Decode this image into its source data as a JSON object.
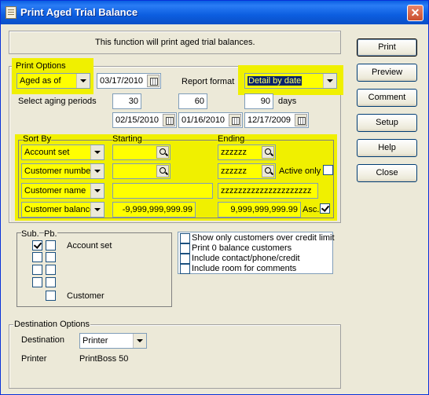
{
  "window": {
    "title": "Print Aged Trial Balance"
  },
  "info": {
    "text": "This function will print aged trial balances."
  },
  "buttons": {
    "print": "Print",
    "preview": "Preview",
    "comment": "Comment",
    "setup": "Setup",
    "help": "Help",
    "close": "Close"
  },
  "print_options": {
    "label": "Print Options",
    "aged_as_of": "Aged as of",
    "as_of_date": "03/17/2010",
    "report_format_label": "Report format",
    "report_format": "Detail by date",
    "aging_label": "Select aging periods",
    "periods": [
      "30",
      "60",
      "90"
    ],
    "days_label": "days",
    "period_dates": [
      "02/15/2010",
      "01/16/2010",
      "12/17/2009"
    ]
  },
  "sort": {
    "sort_by_label": "Sort By",
    "starting_label": "Starting",
    "ending_label": "Ending",
    "rows": [
      {
        "field": "Account set",
        "start": "",
        "end": "zzzzzz"
      },
      {
        "field": "Customer number",
        "start": "",
        "end": "zzzzzz"
      },
      {
        "field": "Customer name",
        "start": "",
        "end": "zzzzzzzzzzzzzzzzzzzzz"
      },
      {
        "field": "Customer balance",
        "start": "-9,999,999,999.99",
        "end": "9,999,999,999.99"
      }
    ],
    "active_only": "Active only",
    "asc": "Asc."
  },
  "sub_pb": {
    "sub_label": "Sub.",
    "pb_label": "Pb.",
    "account_set": "Account set",
    "customer": "Customer"
  },
  "options": [
    "Show only customers over credit limit",
    "Print 0 balance customers",
    "Include contact/phone/credit",
    "Include room for comments"
  ],
  "destination": {
    "label": "Destination Options",
    "dest_label": "Destination",
    "dest_value": "Printer",
    "printer_label": "Printer",
    "printer_value": "PrintBoss 50"
  },
  "colors": {
    "highlight": "#ffff00",
    "titlebar": "#0a5fe3",
    "selection": "#0a246a"
  }
}
